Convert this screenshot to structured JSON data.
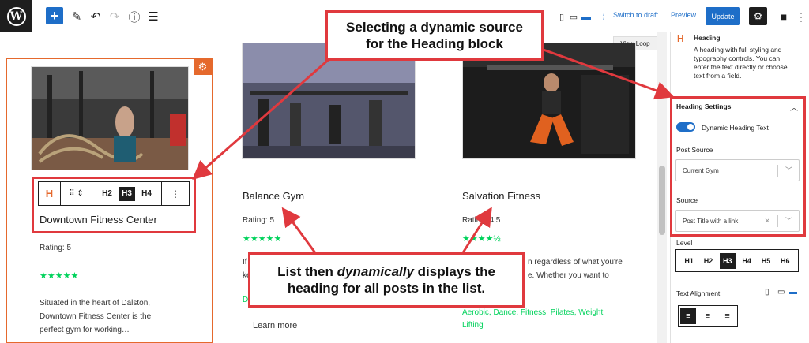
{
  "toolbar": {
    "switch_to_draft": "Switch to draft",
    "preview": "Preview",
    "update": "Update"
  },
  "canvas": {
    "view_loop": "View Loop",
    "cards": [
      {
        "title": "Downtown Fitness Center",
        "rating": "Rating: 5",
        "stars": "★★★★★",
        "description": [
          "Situated in the heart of Dalston,",
          "Downtown Fitness Center is the",
          "perfect gym for working…"
        ]
      },
      {
        "title": "Balance Gym",
        "rating": "Rating: 5",
        "stars": "★★★★★",
        "description_fragment": "If",
        "description_fragment2": "ke",
        "tag_fragment": "D",
        "learn_more": "Learn more"
      },
      {
        "title": "Salvation Fitness",
        "rating": "Rating: 4.5",
        "stars": "★★★★½",
        "description_fragment": "n regardless of what you're",
        "description_fragment2": "e. Whether you want to",
        "tags": "Aerobic, Dance, Fitness, Pilates, Weight",
        "tags2": "Lifting"
      }
    ],
    "block_toolbar": {
      "levels": [
        "H2",
        "H3",
        "H4"
      ],
      "active_level": "H3"
    }
  },
  "callouts": {
    "top": "Selecting a dynamic source for the Heading block",
    "bottom_line1_pre": "List then ",
    "bottom_line1_em": "dynamically",
    "bottom_line1_post": " displays the",
    "bottom_line2": "heading for all posts in the list."
  },
  "sidebar": {
    "block_name": "Heading",
    "block_description": [
      "A heading with full styling and",
      "typography controls. You can",
      "enter the text directly or choose",
      "text from a field."
    ],
    "panel_title": "Heading Settings",
    "toggle_label": "Dynamic Heading Text",
    "post_source_label": "Post Source",
    "post_source_value": "Current Gym",
    "source_label": "Source",
    "source_value": "Post Title with a link",
    "level_label": "Level",
    "levels": [
      "H1",
      "H2",
      "H3",
      "H4",
      "H5",
      "H6"
    ],
    "active_level": "H3",
    "text_alignment_label": "Text Alignment"
  },
  "colors": {
    "accent": "#1e6ec8",
    "highlight": "#e0393e",
    "selection": "#e5692d",
    "star": "#00d25b"
  }
}
